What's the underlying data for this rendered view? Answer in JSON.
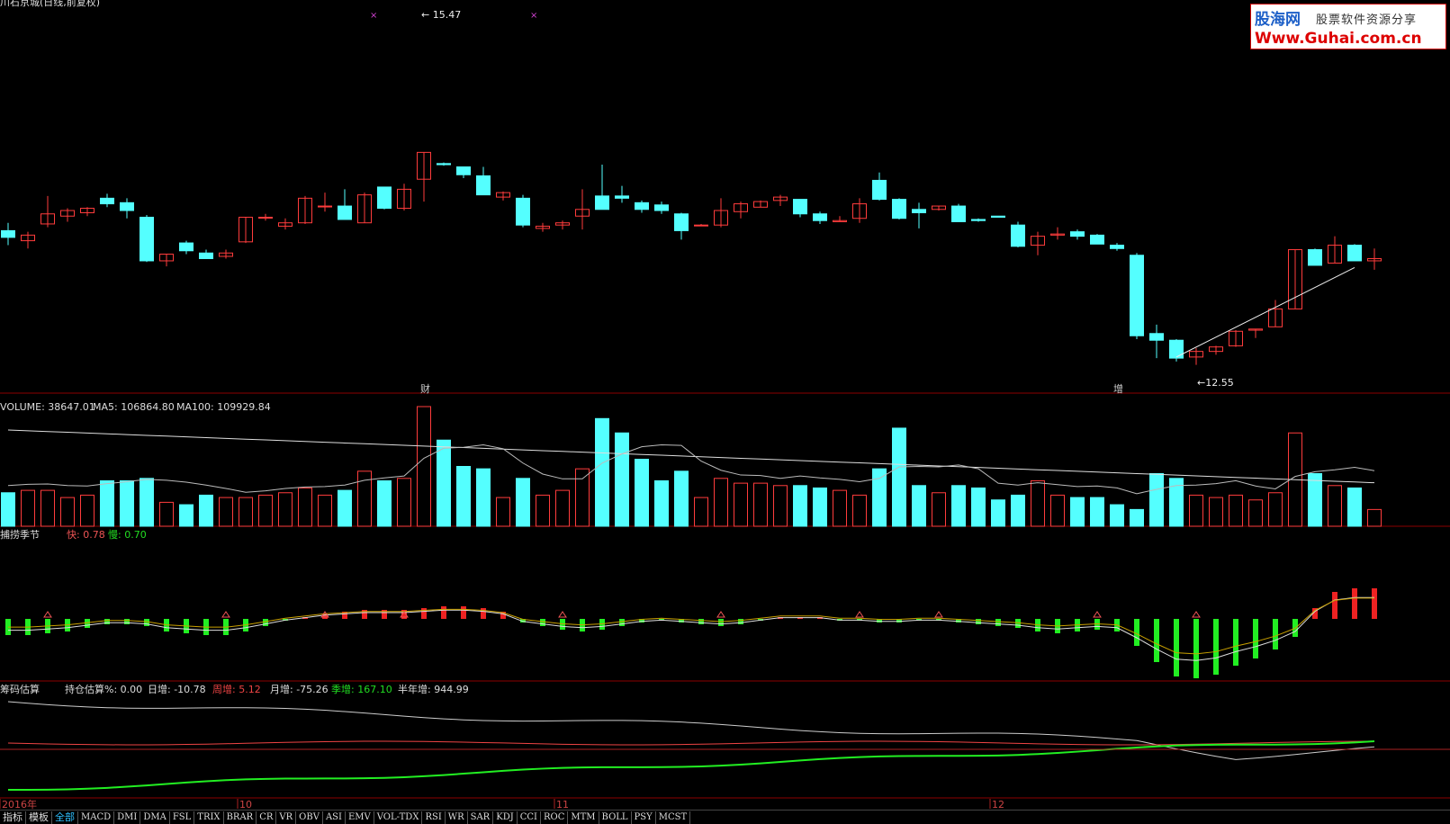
{
  "header": {
    "stock_title": "川石京城(日线,前复权)"
  },
  "logo": {
    "brand": "股海网",
    "slogan": "股票软件资源分享",
    "url": "Www.Guhai.com.cn"
  },
  "price_panel": {
    "high_label": "15.47",
    "low_label": "12.55",
    "markers": [
      {
        "text": "财",
        "index": 21
      },
      {
        "text": "增",
        "index": 56
      }
    ]
  },
  "volume_panel": {
    "label_volume": "VOLUME: 38647.01",
    "label_ma5": "MA5: 106864.80",
    "label_ma100": "MA100: 109929.84"
  },
  "season_panel": {
    "name": "捕捞季节",
    "fast_label": "快: 0.78",
    "slow_label": "慢: 0.70"
  },
  "chip_panel": {
    "name": "筹码估算",
    "hold_label": "持仓估算%: 0.00",
    "day_label": "日增: -10.78",
    "week_label": "周增: 5.12",
    "month_label": "月增: -75.26",
    "quarter_label": "季增: 167.10",
    "half_label": "半年增: 944.99"
  },
  "date_axis": [
    {
      "text": "2016年",
      "index": 0
    },
    {
      "text": "10",
      "index": 12
    },
    {
      "text": "11",
      "index": 28
    },
    {
      "text": "12",
      "index": 50
    }
  ],
  "tabs": [
    "指标",
    "模板",
    "全部",
    "MACD",
    "DMI",
    "DMA",
    "FSL",
    "TRIX",
    "BRAR",
    "CR",
    "VR",
    "OBV",
    "ASI",
    "EMV",
    "VOL-TDX",
    "RSI",
    "WR",
    "SAR",
    "KDJ",
    "CCI",
    "ROC",
    "MTM",
    "BOLL",
    "PSY",
    "MCST"
  ],
  "active_tab": "全部",
  "colors": {
    "up": "#ff3c3c",
    "down": "#54ffff",
    "green": "#22ee22",
    "grid": "#8b0000",
    "ma": "#dddddd"
  },
  "chart_data": {
    "type": "candlestick",
    "title": "川石京城(日线,前复权)",
    "candles": [
      {
        "o": 13.75,
        "h": 13.82,
        "l": 13.62,
        "c": 13.69
      },
      {
        "o": 13.66,
        "h": 13.74,
        "l": 13.59,
        "c": 13.71
      },
      {
        "o": 13.81,
        "h": 14.06,
        "l": 13.78,
        "c": 13.9
      },
      {
        "o": 13.88,
        "h": 13.95,
        "l": 13.83,
        "c": 13.93
      },
      {
        "o": 13.91,
        "h": 13.96,
        "l": 13.88,
        "c": 13.95
      },
      {
        "o": 14.04,
        "h": 14.08,
        "l": 13.96,
        "c": 13.99
      },
      {
        "o": 14.0,
        "h": 14.04,
        "l": 13.86,
        "c": 13.93
      },
      {
        "o": 13.87,
        "h": 13.89,
        "l": 13.47,
        "c": 13.48
      },
      {
        "o": 13.48,
        "h": 13.54,
        "l": 13.43,
        "c": 13.54
      },
      {
        "o": 13.64,
        "h": 13.66,
        "l": 13.54,
        "c": 13.57
      },
      {
        "o": 13.55,
        "h": 13.58,
        "l": 13.5,
        "c": 13.5
      },
      {
        "o": 13.52,
        "h": 13.58,
        "l": 13.5,
        "c": 13.55
      },
      {
        "o": 13.65,
        "h": 13.87,
        "l": 13.64,
        "c": 13.87
      },
      {
        "o": 13.87,
        "h": 13.9,
        "l": 13.84,
        "c": 13.87
      },
      {
        "o": 13.79,
        "h": 13.86,
        "l": 13.76,
        "c": 13.82
      },
      {
        "o": 13.82,
        "h": 14.06,
        "l": 13.81,
        "c": 14.04
      },
      {
        "o": 13.97,
        "h": 14.09,
        "l": 13.92,
        "c": 13.97
      },
      {
        "o": 13.97,
        "h": 14.12,
        "l": 13.92,
        "c": 13.85
      },
      {
        "o": 13.82,
        "h": 14.09,
        "l": 13.82,
        "c": 14.07
      },
      {
        "o": 14.14,
        "h": 14.14,
        "l": 13.94,
        "c": 13.95
      },
      {
        "o": 13.95,
        "h": 14.17,
        "l": 13.93,
        "c": 14.12
      },
      {
        "o": 14.21,
        "h": 14.22,
        "l": 14.01,
        "c": 14.45
      },
      {
        "o": 14.35,
        "h": 14.36,
        "l": 14.33,
        "c": 14.34
      },
      {
        "o": 14.32,
        "h": 14.32,
        "l": 14.22,
        "c": 14.25
      },
      {
        "o": 14.24,
        "h": 14.32,
        "l": 14.1,
        "c": 14.07
      },
      {
        "o": 14.05,
        "h": 14.1,
        "l": 14.02,
        "c": 14.09
      },
      {
        "o": 14.04,
        "h": 14.07,
        "l": 13.78,
        "c": 13.8
      },
      {
        "o": 13.77,
        "h": 13.82,
        "l": 13.74,
        "c": 13.79
      },
      {
        "o": 13.8,
        "h": 13.84,
        "l": 13.76,
        "c": 13.82
      },
      {
        "o": 13.88,
        "h": 14.12,
        "l": 13.76,
        "c": 13.94
      },
      {
        "o": 14.06,
        "h": 14.34,
        "l": 14.06,
        "c": 13.94
      },
      {
        "o": 14.06,
        "h": 14.15,
        "l": 14.0,
        "c": 14.04
      },
      {
        "o": 14.0,
        "h": 14.02,
        "l": 13.91,
        "c": 13.94
      },
      {
        "o": 13.98,
        "h": 14.01,
        "l": 13.9,
        "c": 13.93
      },
      {
        "o": 13.9,
        "h": 13.91,
        "l": 13.67,
        "c": 13.75
      },
      {
        "o": 13.8,
        "h": 13.81,
        "l": 13.8,
        "c": 13.8
      },
      {
        "o": 13.8,
        "h": 14.04,
        "l": 13.78,
        "c": 13.93
      },
      {
        "o": 13.92,
        "h": 14.01,
        "l": 13.86,
        "c": 13.99
      },
      {
        "o": 13.96,
        "h": 14.02,
        "l": 13.97,
        "c": 14.01
      },
      {
        "o": 14.02,
        "h": 14.07,
        "l": 13.97,
        "c": 14.05
      },
      {
        "o": 14.03,
        "h": 14.02,
        "l": 13.87,
        "c": 13.9
      },
      {
        "o": 13.9,
        "h": 13.92,
        "l": 13.81,
        "c": 13.84
      },
      {
        "o": 13.83,
        "h": 13.88,
        "l": 13.83,
        "c": 13.84
      },
      {
        "o": 13.86,
        "h": 14.04,
        "l": 13.82,
        "c": 13.99
      },
      {
        "o": 14.2,
        "h": 14.27,
        "l": 14.02,
        "c": 14.03
      },
      {
        "o": 14.03,
        "h": 14.04,
        "l": 13.85,
        "c": 13.86
      },
      {
        "o": 13.94,
        "h": 14.0,
        "l": 13.77,
        "c": 13.91
      },
      {
        "o": 13.94,
        "h": 13.96,
        "l": 13.93,
        "c": 13.97
      },
      {
        "o": 13.97,
        "h": 13.99,
        "l": 13.92,
        "c": 13.83
      },
      {
        "o": 13.85,
        "h": 13.86,
        "l": 13.83,
        "c": 13.84
      },
      {
        "o": 13.88,
        "h": 13.88,
        "l": 13.87,
        "c": 13.87
      },
      {
        "o": 13.8,
        "h": 13.83,
        "l": 13.6,
        "c": 13.61
      },
      {
        "o": 13.62,
        "h": 13.74,
        "l": 13.53,
        "c": 13.7
      },
      {
        "o": 13.71,
        "h": 13.78,
        "l": 13.67,
        "c": 13.72
      },
      {
        "o": 13.74,
        "h": 13.76,
        "l": 13.67,
        "c": 13.7
      },
      {
        "o": 13.71,
        "h": 13.72,
        "l": 13.65,
        "c": 13.63
      },
      {
        "o": 13.62,
        "h": 13.64,
        "l": 13.57,
        "c": 13.59
      },
      {
        "o": 13.53,
        "h": 13.55,
        "l": 12.78,
        "c": 12.81
      },
      {
        "o": 12.83,
        "h": 12.91,
        "l": 12.61,
        "c": 12.77
      },
      {
        "o": 12.77,
        "h": 12.78,
        "l": 12.58,
        "c": 12.61
      },
      {
        "o": 12.62,
        "h": 12.7,
        "l": 12.55,
        "c": 12.67
      },
      {
        "o": 12.67,
        "h": 12.72,
        "l": 12.64,
        "c": 12.71
      },
      {
        "o": 12.72,
        "h": 12.86,
        "l": 12.71,
        "c": 12.85
      },
      {
        "o": 12.86,
        "h": 12.87,
        "l": 12.79,
        "c": 12.87
      },
      {
        "o": 12.89,
        "h": 13.13,
        "l": 12.95,
        "c": 13.05
      },
      {
        "o": 13.05,
        "h": 13.58,
        "l": 13.05,
        "c": 13.58
      },
      {
        "o": 13.58,
        "h": 13.59,
        "l": 13.44,
        "c": 13.44
      },
      {
        "o": 13.46,
        "h": 13.7,
        "l": 13.46,
        "c": 13.62
      },
      {
        "o": 13.62,
        "h": 13.63,
        "l": 13.53,
        "c": 13.48
      },
      {
        "o": 13.48,
        "h": 13.59,
        "l": 13.4,
        "c": 13.5
      }
    ],
    "trend_line": {
      "from_index": 59,
      "to_index": 68,
      "from_value": 12.62,
      "to_value": 13.42
    },
    "volume_range": [
      0,
      120000
    ],
    "price_range": [
      12.45,
      15.7
    ]
  }
}
